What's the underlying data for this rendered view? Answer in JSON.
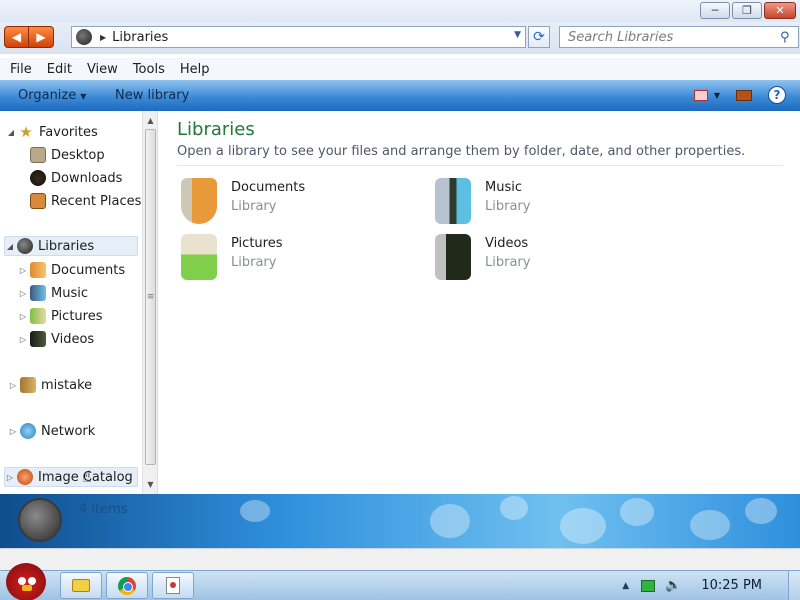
{
  "window": {
    "controls": {
      "minimize": "─",
      "maximize": "❐",
      "close": "✕"
    }
  },
  "address": {
    "path": "Libraries",
    "search_placeholder": "Search Libraries"
  },
  "menu": [
    "File",
    "Edit",
    "View",
    "Tools",
    "Help"
  ],
  "commands": {
    "organize": "Organize",
    "new_library": "New library"
  },
  "nav": {
    "favorites": {
      "label": "Favorites",
      "items": [
        "Desktop",
        "Downloads",
        "Recent Places"
      ]
    },
    "libraries": {
      "label": "Libraries",
      "items": [
        "Documents",
        "Music",
        "Pictures",
        "Videos"
      ]
    },
    "mistake": "mistake",
    "network": "Network",
    "image_catalog": "Image Catalog"
  },
  "content": {
    "title": "Libraries",
    "description": "Open a library to see your files and arrange them by folder, date, and other properties.",
    "libraries": [
      {
        "name": "Documents",
        "type": "Library"
      },
      {
        "name": "Music",
        "type": "Library"
      },
      {
        "name": "Pictures",
        "type": "Library"
      },
      {
        "name": "Videos",
        "type": "Library"
      }
    ]
  },
  "details": {
    "count": "4 items"
  },
  "taskbar": {
    "clock": "10:25 PM"
  },
  "colors": {
    "title_green": "#1f7a3a",
    "command_bar": "#3c8ad6",
    "accent_orange": "#d0420a"
  }
}
